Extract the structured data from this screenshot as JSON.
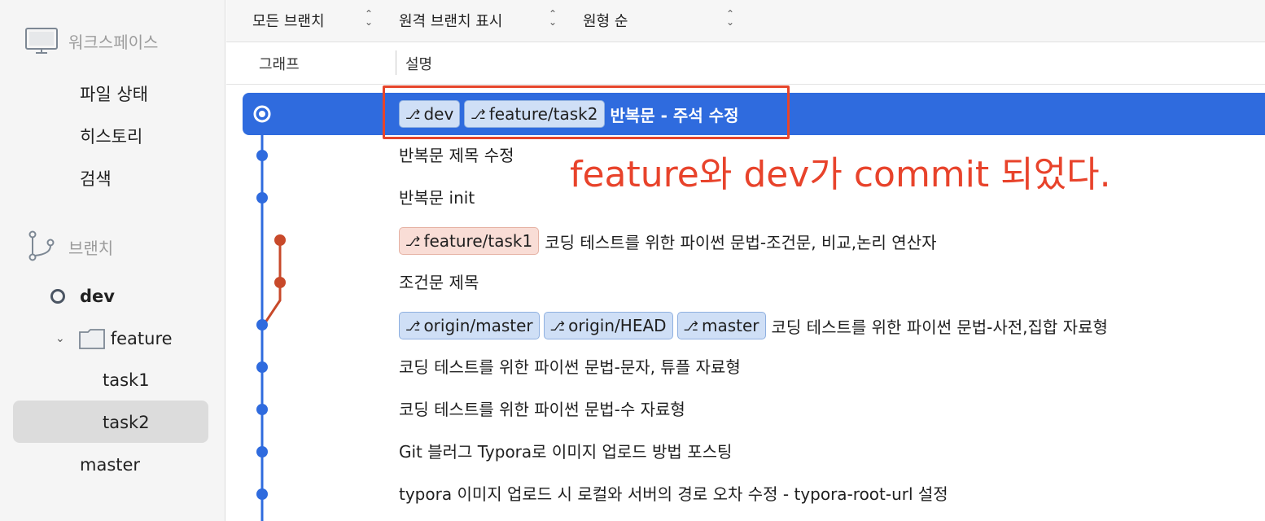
{
  "sidebar": {
    "workspace_label": "워크스페이스",
    "workspace_items": [
      "파일 상태",
      "히스토리",
      "검색"
    ],
    "branches_label": "브랜치",
    "branch_current": "dev",
    "feature_folder": "feature",
    "feature_children": [
      "task1",
      "task2"
    ],
    "master": "master"
  },
  "header": {
    "all_branches": "모든 브랜치",
    "show_remote": "원격 브랜치 표시",
    "order": "원형 순",
    "col_graph": "그래프",
    "col_desc": "설명"
  },
  "commits": [
    {
      "tags": [
        {
          "label": "dev",
          "color": "blue"
        },
        {
          "label": "feature/task2",
          "color": "blue"
        }
      ],
      "message": "반복문 - 주석 수정",
      "selected": true
    },
    {
      "tags": [],
      "message": "반복문 제목 수정"
    },
    {
      "tags": [],
      "message": "반복문 init"
    },
    {
      "tags": [
        {
          "label": "feature/task1",
          "color": "orange"
        }
      ],
      "message": "코딩 테스트를 위한 파이썬 문법-조건문, 비교,논리 연산자"
    },
    {
      "tags": [],
      "message": "조건문 제목"
    },
    {
      "tags": [
        {
          "label": "origin/master",
          "color": "blue"
        },
        {
          "label": "origin/HEAD",
          "color": "blue"
        },
        {
          "label": "master",
          "color": "blue"
        }
      ],
      "message": "코딩 테스트를 위한 파이썬 문법-사전,집합 자료형"
    },
    {
      "tags": [],
      "message": "코딩 테스트를 위한 파이썬 문법-문자, 튜플 자료형"
    },
    {
      "tags": [],
      "message": "코딩 테스트를 위한 파이썬 문법-수 자료형"
    },
    {
      "tags": [],
      "message": "Git 블러그 Typora로 이미지 업로드 방법 포스팅"
    },
    {
      "tags": [],
      "message": "typora 이미지 업로드 시 로컬와 서버의 경로 오차 수정 - typora-root-url 설정"
    }
  ],
  "annotation": "feature와 dev가 commit 되었다.",
  "colors": {
    "selected_row": "#2f6bde",
    "main_lane": "#2f6bde",
    "feature_lane": "#c8492a",
    "annotation": "#e8432b"
  }
}
